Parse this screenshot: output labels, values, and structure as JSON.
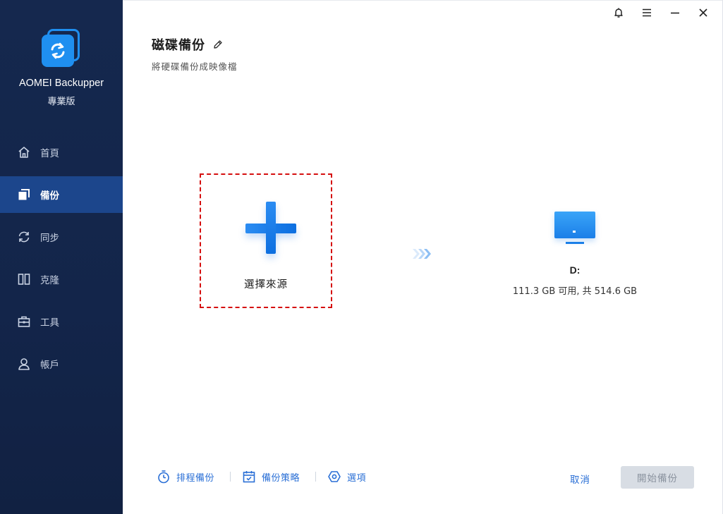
{
  "app": {
    "name": "AOMEI Backupper",
    "edition": "專業版"
  },
  "sidebar": {
    "items": [
      {
        "label": "首頁",
        "icon": "home-icon",
        "active": false
      },
      {
        "label": "備份",
        "icon": "backup-icon",
        "active": true
      },
      {
        "label": "同步",
        "icon": "sync-icon",
        "active": false
      },
      {
        "label": "克隆",
        "icon": "clone-icon",
        "active": false
      },
      {
        "label": "工具",
        "icon": "toolbox-icon",
        "active": false
      },
      {
        "label": "帳戶",
        "icon": "user-icon",
        "active": false
      }
    ]
  },
  "window_controls": [
    "bell-icon",
    "menu-icon",
    "minimize-icon",
    "close-icon"
  ],
  "header": {
    "title": "磁碟備份",
    "subtitle": "將硬碟備份成映像檔"
  },
  "source": {
    "label": "選擇來源"
  },
  "destination": {
    "name": "D:",
    "info": "111.3 GB 可用, 共 514.6 GB"
  },
  "bottom": {
    "schedule_label": "排程備份",
    "scheme_label": "備份策略",
    "options_label": "選項",
    "cancel_label": "取消",
    "start_label": "開始備份"
  },
  "colors": {
    "sidebar_bg": "#15284e",
    "sidebar_active": "#1c468c",
    "accent": "#1f8ff0",
    "link": "#2a6fd6",
    "dashed_border": "#d50f0f",
    "disabled_button": "#d8dde4"
  }
}
